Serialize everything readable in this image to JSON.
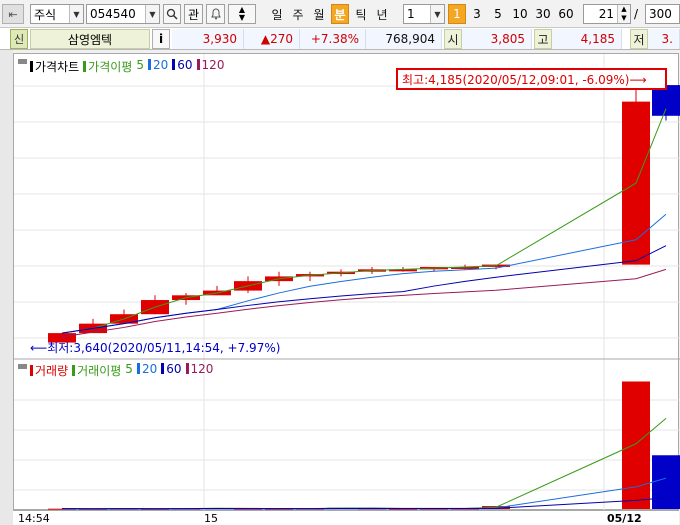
{
  "toolbar": {
    "market": "주식",
    "code": "054540",
    "search_icon": "magnifier-icon",
    "watch_label": "관",
    "bell_icon": "bell-icon",
    "updown_icon": "up-down-icon",
    "periods": [
      "일",
      "주",
      "월",
      "분",
      "틱",
      "년"
    ],
    "selected_period": "분",
    "interval_value": "1",
    "interval_buttons": [
      "1",
      "3",
      "5",
      "10",
      "30",
      "60"
    ],
    "selected_interval": "1",
    "count_value": "21",
    "slash": "/",
    "total_value": "300"
  },
  "quote": {
    "badge": "신",
    "name": "삼영엠텍",
    "info_label": "i",
    "price": "3,930",
    "change": "▲270",
    "change_pct": "+7.38%",
    "volume": "768,904",
    "open_label": "시",
    "open": "3,805",
    "high_label": "고",
    "high": "4,185",
    "low_label": "저",
    "low": "3."
  },
  "price_pane": {
    "legend": [
      {
        "label": "가격차트",
        "color": "#000000"
      },
      {
        "label": "가격이평",
        "color": "#3a9a1a"
      },
      {
        "label": "5",
        "color": "#3a9a1a"
      },
      {
        "label": "20",
        "color": "#1a6ee0"
      },
      {
        "label": "60",
        "color": "#0000b0"
      },
      {
        "label": "120",
        "color": "#9a1a5a"
      }
    ],
    "high_callout": "최고:4,185(2020/05/12,09:01, -6.09%)⟶",
    "low_callout": "⟵최저:3,640(2020/05/11,14:54, +7.97%)"
  },
  "volume_pane": {
    "legend": [
      {
        "label": "거래량",
        "color": "#e00000"
      },
      {
        "label": "거래이평",
        "color": "#3a9a1a"
      },
      {
        "label": "5",
        "color": "#3a9a1a"
      },
      {
        "label": "20",
        "color": "#1a6ee0"
      },
      {
        "label": "60",
        "color": "#0000b0"
      },
      {
        "label": "120",
        "color": "#9a1a5a"
      }
    ]
  },
  "xaxis": {
    "labels": [
      "14:54",
      "15",
      "05/12"
    ]
  },
  "chart_data": {
    "type": "bar",
    "title": "",
    "candles": [
      {
        "o": 3640,
        "h": 3660,
        "l": 3640,
        "c": 3660
      },
      {
        "o": 3660,
        "h": 3690,
        "l": 3660,
        "c": 3680
      },
      {
        "o": 3680,
        "h": 3710,
        "l": 3680,
        "c": 3700
      },
      {
        "o": 3700,
        "h": 3740,
        "l": 3700,
        "c": 3730
      },
      {
        "o": 3730,
        "h": 3745,
        "l": 3720,
        "c": 3740
      },
      {
        "o": 3740,
        "h": 3760,
        "l": 3740,
        "c": 3750
      },
      {
        "o": 3750,
        "h": 3780,
        "l": 3745,
        "c": 3770
      },
      {
        "o": 3770,
        "h": 3790,
        "l": 3760,
        "c": 3780
      },
      {
        "o": 3780,
        "h": 3790,
        "l": 3770,
        "c": 3785
      },
      {
        "o": 3785,
        "h": 3795,
        "l": 3780,
        "c": 3790
      },
      {
        "o": 3790,
        "h": 3800,
        "l": 3785,
        "c": 3795
      },
      {
        "o": 3795,
        "h": 3800,
        "l": 3790,
        "c": 3795
      },
      {
        "o": 3795,
        "h": 3800,
        "l": 3790,
        "c": 3800
      },
      {
        "o": 3800,
        "h": 3805,
        "l": 3795,
        "c": 3800
      },
      {
        "o": 3800,
        "h": 3805,
        "l": 3795,
        "c": 3805
      },
      {
        "o": 3805,
        "h": 4185,
        "l": 3805,
        "c": 4150
      },
      {
        "o": 4185,
        "h": 4185,
        "l": 4110,
        "c": 4120
      }
    ],
    "volume": [
      300,
      200,
      400,
      200,
      500,
      900,
      400,
      300,
      500,
      1200,
      700,
      300,
      400,
      500,
      2800,
      121000,
      51000
    ],
    "ylim_price": [
      3620,
      4200
    ],
    "ylim_volume": [
      0,
      130000
    ]
  }
}
